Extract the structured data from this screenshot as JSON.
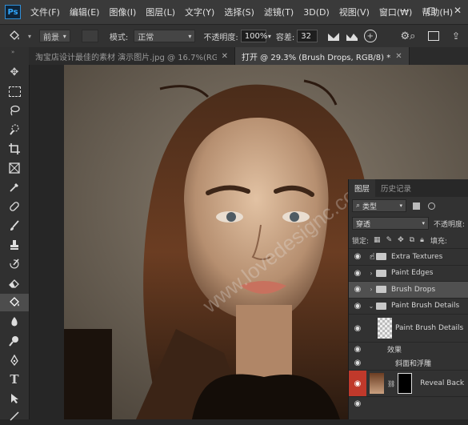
{
  "menubar": {
    "logo": "Ps",
    "items": [
      "文件(F)",
      "编辑(E)",
      "图像(I)",
      "图层(L)",
      "文字(Y)",
      "选择(S)",
      "滤镜(T)",
      "3D(D)",
      "视图(V)",
      "窗口(W)",
      "帮助(H)"
    ],
    "window_controls": [
      "—",
      "▢",
      "✕"
    ]
  },
  "options": {
    "fill_source": "前景",
    "mode_label": "模式:",
    "mode_value": "正常",
    "opacity_label": "不透明度:",
    "opacity_value": "100%",
    "tolerance_label": "容差:",
    "tolerance_value": "32"
  },
  "tabs": [
    {
      "label": "淘宝店设计最佳的素材 演示图片.jpg @ 16.7%(RGB/8)",
      "close": "✕"
    },
    {
      "label": "打开 @ 29.3% (Brush Drops, RGB/8) *",
      "close": "✕"
    }
  ],
  "watermark": "www.lovedesignc.com",
  "panel": {
    "tabs": [
      "图层",
      "历史记录"
    ],
    "filter_label": "类型",
    "blend_mode": "穿透",
    "opacity_label": "不透明度:",
    "lock_label": "锁定:",
    "fill_label": "填充:",
    "layers": [
      {
        "name": "Extra Textures",
        "type": "group",
        "selected": false
      },
      {
        "name": "Paint Edges",
        "type": "group",
        "selected": false
      },
      {
        "name": "Brush Drops",
        "type": "group",
        "selected": true
      },
      {
        "name": "Paint Brush Details",
        "type": "group-open",
        "selected": false
      },
      {
        "name": "Paint Brush Details",
        "type": "layer",
        "selected": false
      },
      {
        "name": "效果",
        "type": "effects",
        "selected": false
      },
      {
        "name": "斜面和浮雕",
        "type": "effect",
        "selected": false
      },
      {
        "name": "Reveal Back",
        "type": "masked-layer",
        "selected": false
      }
    ]
  },
  "colors": {
    "eye_active": "#c0392b",
    "selected_layer": "#505050",
    "menubar": "#3a3a3a",
    "accent": "#31a8ff"
  }
}
